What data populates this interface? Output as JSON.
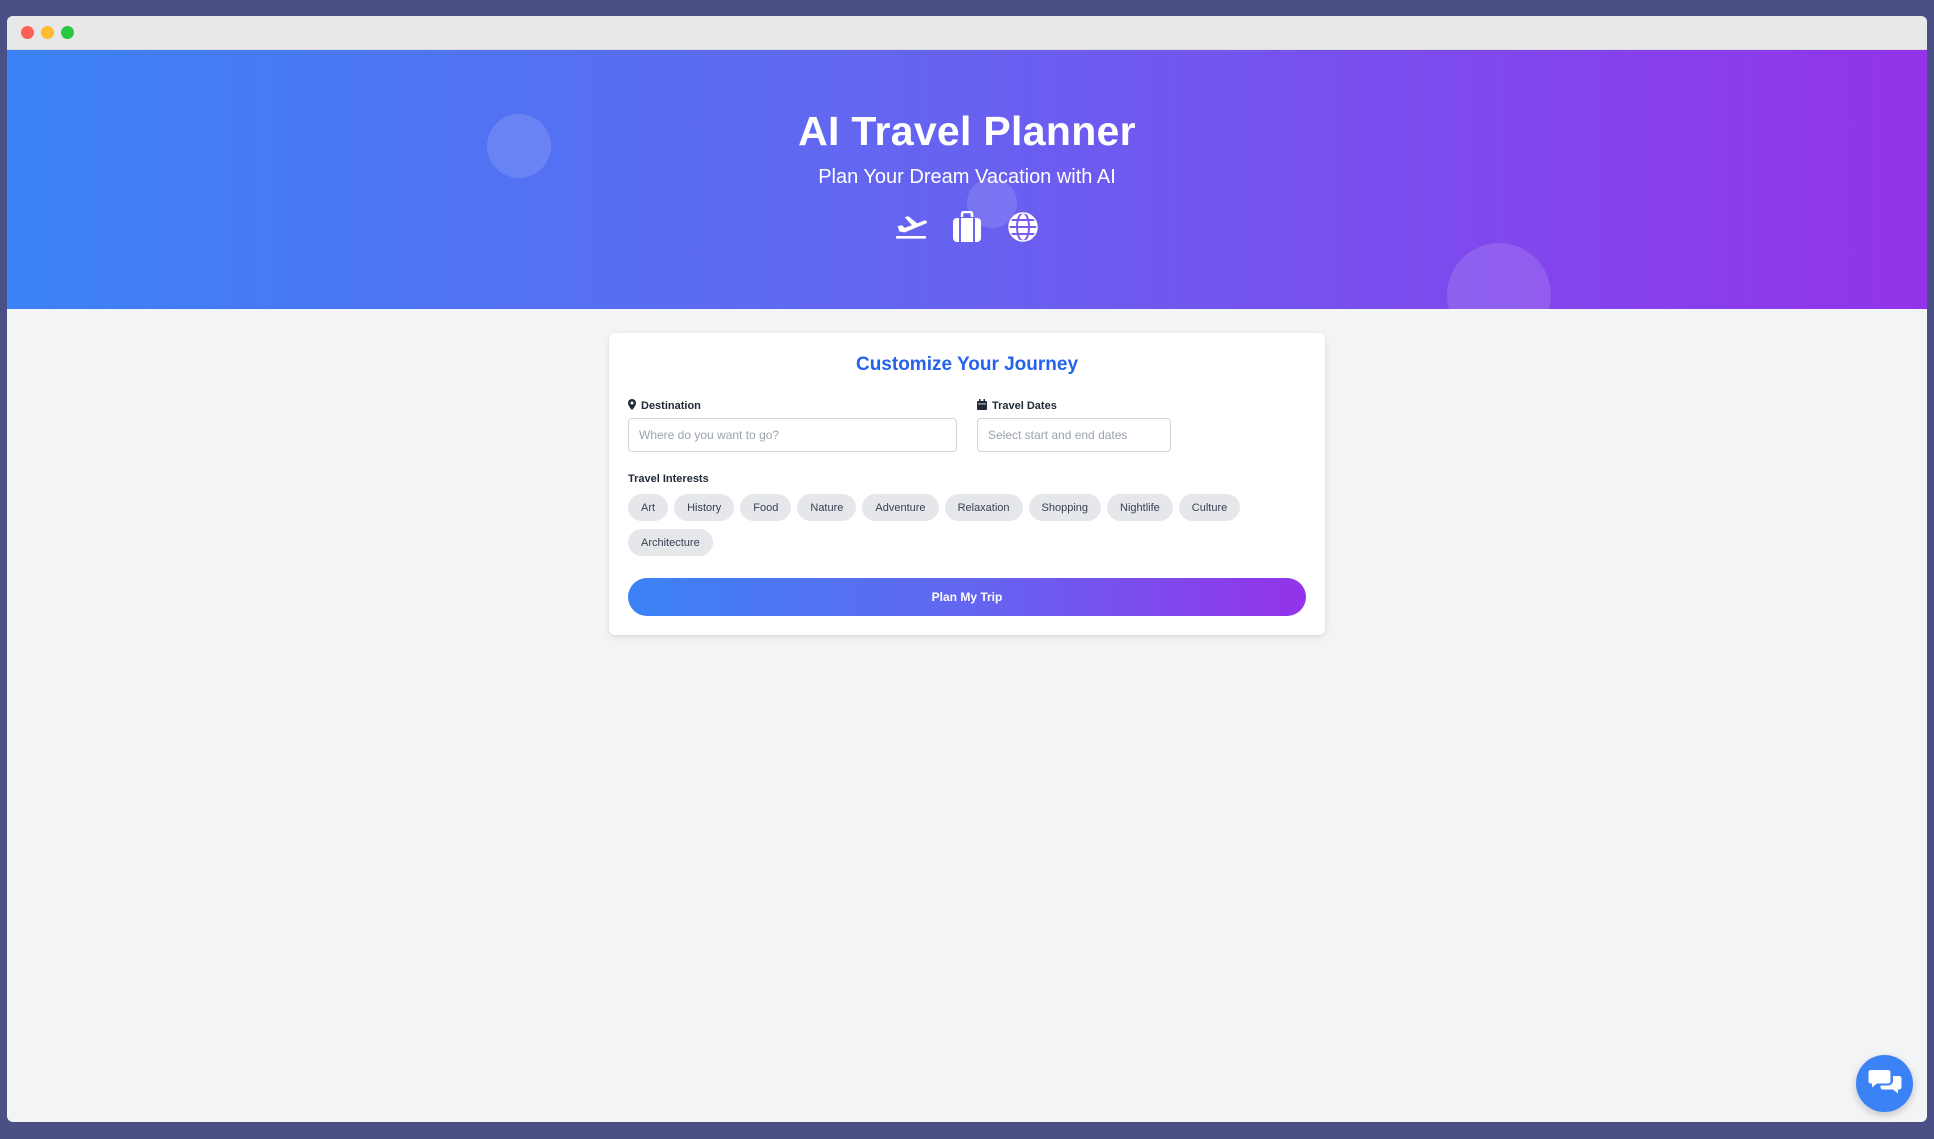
{
  "window": {
    "controls": [
      "close",
      "minimize",
      "maximize"
    ]
  },
  "hero": {
    "title": "AI Travel Planner",
    "subtitle": "Plan Your Dream Vacation with AI",
    "icons": [
      "plane-departure-icon",
      "suitcase-icon",
      "globe-icon"
    ],
    "gradient": [
      "#3b82f6",
      "#6366f1",
      "#9333ea"
    ]
  },
  "form": {
    "title": "Customize Your Journey",
    "destination": {
      "label": "Destination",
      "icon": "map-marker-icon",
      "placeholder": "Where do you want to go?",
      "value": ""
    },
    "dates": {
      "label": "Travel Dates",
      "icon": "calendar-icon",
      "placeholder": "Select start and end dates",
      "value": ""
    },
    "interests": {
      "label": "Travel Interests",
      "options": [
        "Art",
        "History",
        "Food",
        "Nature",
        "Adventure",
        "Relaxation",
        "Shopping",
        "Nightlife",
        "Culture",
        "Architecture"
      ]
    },
    "submit_label": "Plan My Trip"
  },
  "chat": {
    "icon": "chat-bubbles-icon",
    "color": "#3b82f6"
  }
}
